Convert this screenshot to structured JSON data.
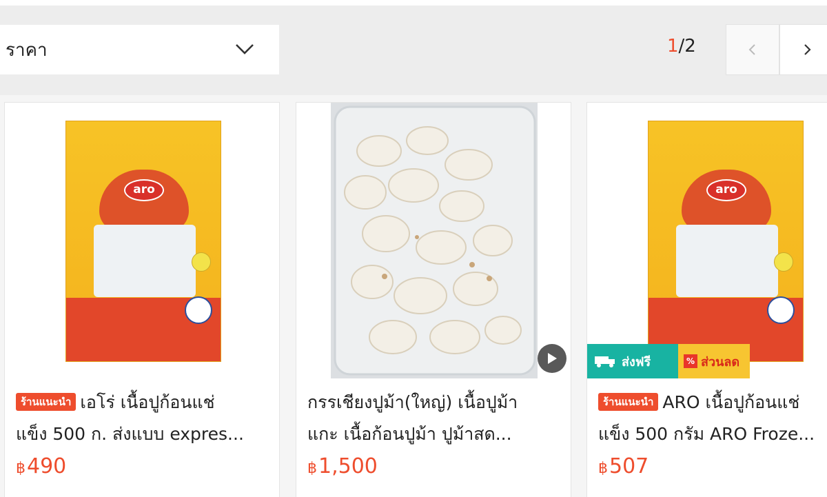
{
  "filter": {
    "sort_label": "ราคา",
    "page_current": "1",
    "page_total": "/2"
  },
  "products": [
    {
      "shop_badge": "ร้านแนะนำ",
      "title_line1": "เอโร่ เนื้อปูก้อนแช่",
      "title_line2": "แข็ง 500 ก. ส่งแบบ expres...",
      "price_symbol": "฿",
      "price": "490",
      "brand_logo": "aro"
    },
    {
      "title_line1": "กรรเชียงปูม้า(ใหญ่) เนื้อปูม้า",
      "title_line2": "แกะ เนื้อก้อนปูม้า ปูม้าสด...",
      "price_symbol": "฿",
      "price": "1,500"
    },
    {
      "shop_badge": "ร้านแนะนำ",
      "title_line1": "ARO เนื้อปูก้อนแช่",
      "title_line2": "แข็ง 500 กรัม ARO Froze...",
      "price_symbol": "฿",
      "price": "507",
      "brand_logo": "aro",
      "promo_free": "ส่งฟรี",
      "promo_discount": "ส่วนลด"
    }
  ],
  "colors": {
    "accent": "#ee4d2d",
    "free_shipping": "#18b3a2",
    "discount": "#f7c531"
  }
}
